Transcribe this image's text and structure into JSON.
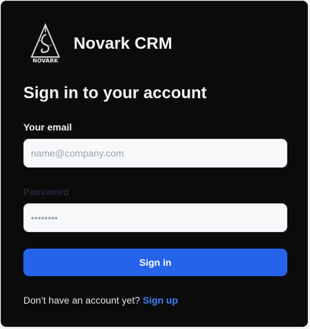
{
  "brand": {
    "name": "Novark CRM",
    "logo_text": "NOVARK",
    "logo_icon": "novark-logo-icon"
  },
  "form": {
    "title": "Sign in to your account",
    "email": {
      "label": "Your email",
      "placeholder": "name@company.com",
      "value": ""
    },
    "password": {
      "label": "Password",
      "placeholder": "••••••••",
      "value": ""
    },
    "submit_label": "Sign in"
  },
  "signup": {
    "prompt": "Don’t have an account yet?",
    "link_label": "Sign up"
  },
  "colors": {
    "background": "#0b0b0c",
    "accent": "#2563eb",
    "link": "#3b82f6"
  }
}
